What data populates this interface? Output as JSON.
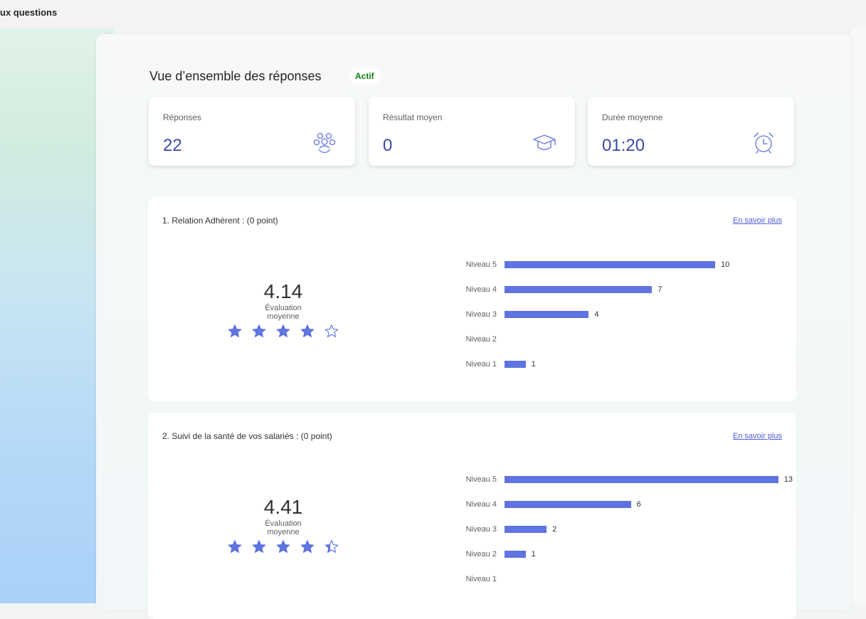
{
  "page": {
    "title": "ux questions"
  },
  "overview": {
    "title": "Vue d’ensemble des réponses",
    "status": "Actif",
    "accent_color": "#3b48a8",
    "stats": [
      {
        "label": "Réponses",
        "value": "22",
        "icon": "people-icon"
      },
      {
        "label": "Résultat moyen",
        "value": "0",
        "icon": "graduation-cap-icon"
      },
      {
        "label": "Durée moyenne",
        "value": "01:20",
        "icon": "alarm-clock-icon"
      }
    ]
  },
  "questions": [
    {
      "title": "1. Relation Adhérent :  (0 point)",
      "link": "En savoir plus",
      "average": "4.14",
      "average_label": "Évaluation moyenne",
      "rating": 4.14,
      "chart_data": {
        "type": "bar",
        "orientation": "horizontal",
        "categories": [
          "Niveau 5",
          "Niveau 4",
          "Niveau 3",
          "Niveau 2",
          "Niveau 1"
        ],
        "values": [
          10,
          7,
          4,
          0,
          1
        ],
        "value_labels": [
          "10",
          "7",
          "4",
          "",
          "1"
        ],
        "color": "#5f74e0"
      }
    },
    {
      "title": "2. Suivi de la santé de vos salariés :  (0 point)",
      "link": "En savoir plus",
      "average": "4.41",
      "average_label": "Évaluation moyenne",
      "rating": 4.41,
      "chart_data": {
        "type": "bar",
        "orientation": "horizontal",
        "categories": [
          "Niveau 5",
          "Niveau 4",
          "Niveau 3",
          "Niveau 2",
          "Niveau 1"
        ],
        "values": [
          13,
          6,
          2,
          1,
          0
        ],
        "value_labels": [
          "13",
          "6",
          "2",
          "1",
          ""
        ],
        "color": "#5f74e0"
      }
    }
  ]
}
